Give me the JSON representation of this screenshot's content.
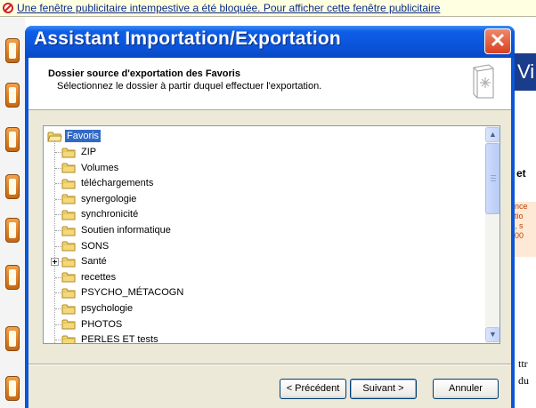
{
  "infobar": {
    "text": "Une fenêtre publicitaire intempestive a été bloquée. Pour afficher cette fenêtre publicitaire"
  },
  "background": {
    "right_title": "Vi",
    "right_text": "et",
    "box_lines": [
      "nce",
      "tio",
      ", s",
      "00"
    ],
    "text_bottom1": "ttr",
    "text_bottom2": "du"
  },
  "dialog": {
    "title": "Assistant Importation/Exportation",
    "header_title": "Dossier source d'exportation des Favoris",
    "header_subtitle": "Sélectionnez le dossier à partir duquel effectuer l'exportation.",
    "tree": {
      "root": "Favoris",
      "items": [
        {
          "label": "ZIP"
        },
        {
          "label": "Volumes"
        },
        {
          "label": "téléchargements"
        },
        {
          "label": "synergologie"
        },
        {
          "label": "synchronicité"
        },
        {
          "label": "Soutien informatique"
        },
        {
          "label": "SONS"
        },
        {
          "label": "Santé",
          "expandable": true
        },
        {
          "label": "recettes"
        },
        {
          "label": "PSYCHO_MÉTACOGN"
        },
        {
          "label": "psychologie"
        },
        {
          "label": "PHOTOS"
        },
        {
          "label": "PERLES ET tests"
        }
      ]
    },
    "buttons": {
      "back": "< Précédent",
      "next": "Suivant >",
      "cancel": "Annuler"
    }
  },
  "colors": {
    "titlebar": "#0a52d6",
    "selection": "#316ac5",
    "dialog_bg": "#ece9d8"
  },
  "icons": {
    "close": "close-icon",
    "folder": "folder-icon",
    "blocked": "popup-blocked-icon",
    "favorites": "favorites-book-icon"
  }
}
